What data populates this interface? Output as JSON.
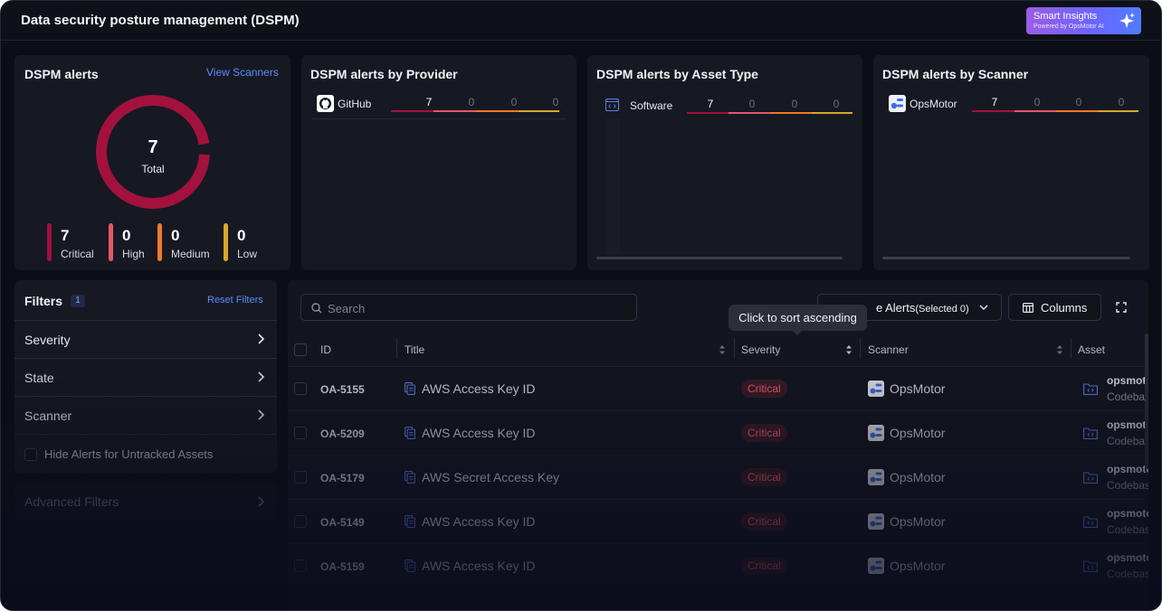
{
  "header": {
    "title": "Data security posture management (DSPM)",
    "smart_insights": {
      "label": "Smart Insights",
      "sub": "Powered by OpsMotor AI",
      "icon": "sparkle-icon"
    }
  },
  "alerts_card": {
    "title": "DSPM alerts",
    "view_scanners": "View Scanners",
    "total_value": "7",
    "total_label": "Total",
    "severities": [
      {
        "label": "Critical",
        "value": "7",
        "color": "#a3113e"
      },
      {
        "label": "High",
        "value": "0",
        "color": "#e5566a"
      },
      {
        "label": "Medium",
        "value": "0",
        "color": "#f07a2d"
      },
      {
        "label": "Low",
        "value": "0",
        "color": "#d9a72a"
      }
    ]
  },
  "provider_card": {
    "title": "DSPM alerts by Provider",
    "rows": [
      {
        "name": "GitHub",
        "icon": "github-icon",
        "counts": [
          "7",
          "0",
          "0",
          "0"
        ]
      }
    ]
  },
  "asset_type_card": {
    "title": "DSPM alerts by Asset Type",
    "rows": [
      {
        "name": "Software",
        "icon": "code-window-icon",
        "counts": [
          "7",
          "0",
          "0",
          "0"
        ]
      }
    ]
  },
  "scanner_card": {
    "title": "DSPM alerts by Scanner",
    "rows": [
      {
        "name": "OpsMotor",
        "icon": "opsmotor-icon",
        "counts": [
          "7",
          "0",
          "0",
          "0"
        ]
      }
    ]
  },
  "filters": {
    "title": "Filters",
    "count": "1",
    "reset": "Reset Filters",
    "items": [
      "Severity",
      "State",
      "Scanner"
    ],
    "hide_untracked": "Hide Alerts for Untracked Assets",
    "advanced": "Advanced Filters"
  },
  "table": {
    "search_placeholder": "Search",
    "manage_alerts": "e Alerts",
    "manage_selected": "(Selected 0)",
    "columns_btn": "Columns",
    "tooltip": "Click to sort ascending",
    "headers": [
      "ID",
      "Title",
      "Severity",
      "Scanner",
      "Asset"
    ],
    "rows": [
      {
        "id": "OA-5155",
        "title": "AWS Access Key ID",
        "severity": "Critical",
        "scanner": "OpsMotor",
        "asset": "opsmotor",
        "asset_type": "Codebase"
      },
      {
        "id": "OA-5209",
        "title": "AWS Access Key ID",
        "severity": "Critical",
        "scanner": "OpsMotor",
        "asset": "opsmotor",
        "asset_type": "Codebase"
      },
      {
        "id": "OA-5179",
        "title": "AWS Secret Access Key",
        "severity": "Critical",
        "scanner": "OpsMotor",
        "asset": "opsmotor",
        "asset_type": "Codebase"
      },
      {
        "id": "OA-5149",
        "title": "AWS Access Key ID",
        "severity": "Critical",
        "scanner": "OpsMotor",
        "asset": "opsmotor",
        "asset_type": "Codebase"
      },
      {
        "id": "OA-5159",
        "title": "AWS Access Key ID",
        "severity": "Critical",
        "scanner": "OpsMotor",
        "asset": "opsmotor",
        "asset_type": "Codebase"
      }
    ]
  },
  "colors": {
    "critical": "#a3113e",
    "high": "#e5566a",
    "medium": "#f07a2d",
    "low": "#d9a72a",
    "accent": "#5b8cff"
  }
}
